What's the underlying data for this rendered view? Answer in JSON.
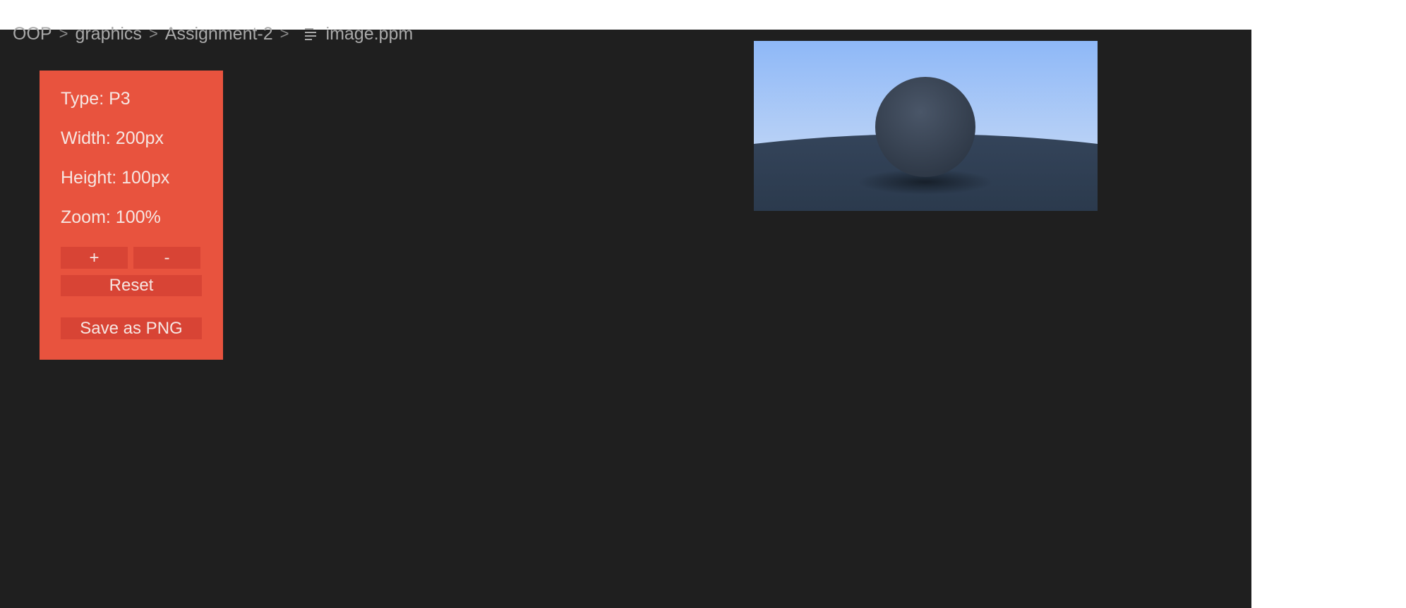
{
  "breadcrumb": {
    "items": [
      "OOP",
      "graphics",
      "Assignment-2"
    ],
    "separator": ">",
    "file_name": "image.ppm",
    "file_icon": "lines-file-icon"
  },
  "info_panel": {
    "type_line": "Type: P3",
    "width_line": "Width: 200px",
    "height_line": "Height: 100px",
    "zoom_line": "Zoom: 100%",
    "zoom_in_label": "+",
    "zoom_out_label": "-",
    "reset_label": "Reset",
    "save_label": "Save as PNG"
  },
  "colors": {
    "editor_background": "#1f1f1f",
    "panel_background": "#e8533e",
    "button_background": "#d84435",
    "sky_top": "#8eb8f7",
    "sky_bottom": "#d3e1f6",
    "ground": "#2e3e52",
    "sphere": "#3a4656"
  }
}
